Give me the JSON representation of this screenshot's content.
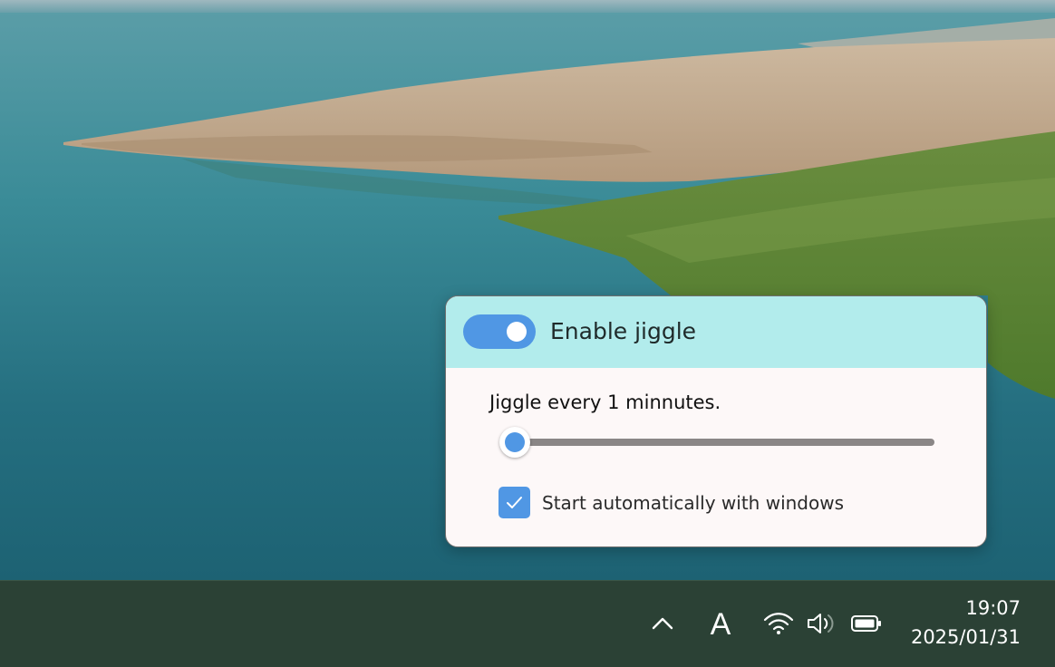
{
  "app": {
    "toggle_label": "Enable jiggle",
    "toggle_on": true,
    "interval_label": "Jiggle every 1 minnutes.",
    "slider_level": 0.0,
    "autostart_label": "Start automatically with windows",
    "autostart_checked": true,
    "colors": {
      "accent": "#5097e4",
      "header_bg": "#b2ecec",
      "panel_bg": "#fdf8f8"
    }
  },
  "taskbar": {
    "ime_label": "A",
    "time": "19:07",
    "date": "2025/01/31",
    "tray_icons": [
      "chevron-up-icon",
      "wifi-icon",
      "volume-icon",
      "battery-icon"
    ],
    "background": "#2b4135"
  }
}
